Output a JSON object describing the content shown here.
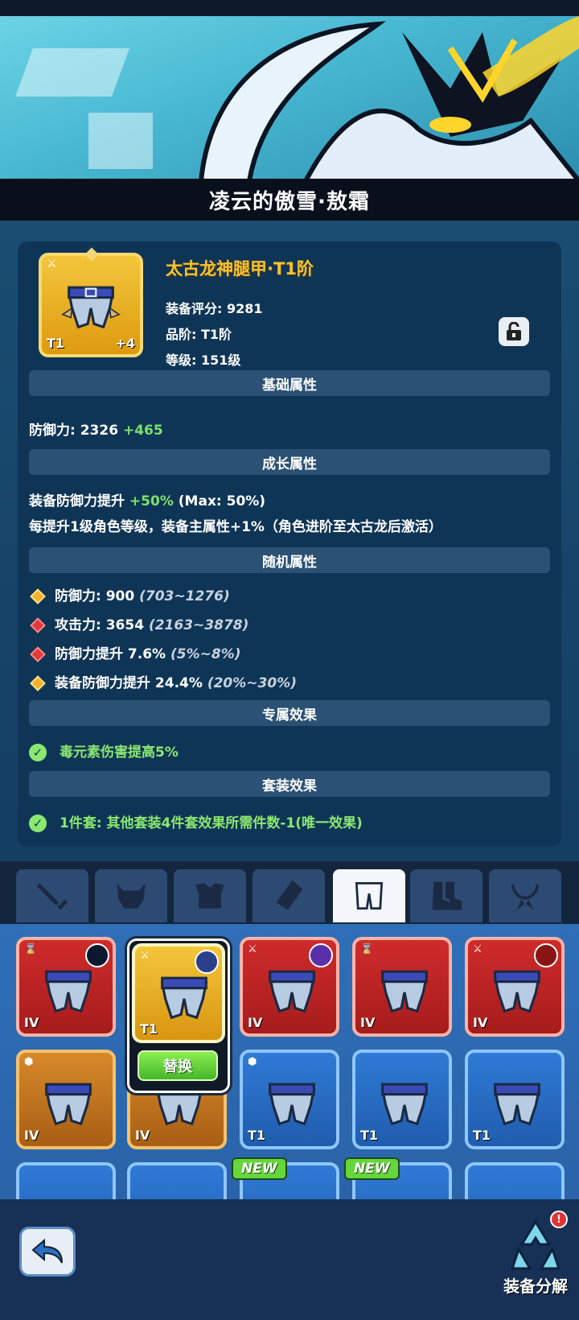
{
  "character_title": "凌云的傲雪·敖霜",
  "item": {
    "name": "太古龙神腿甲·T1阶",
    "score": "装备评分: 9281",
    "grade": "品阶: T1阶",
    "level": "等级: 151级",
    "tier_badge": "T1",
    "plus_badge": "+4",
    "icon_name": "leg-armor-icon"
  },
  "sections": {
    "basic": "基础属性",
    "growth": "成长属性",
    "random": "随机属性",
    "exclusive": "专属效果",
    "set": "套装效果"
  },
  "basic_attr": {
    "label": "防御力: 2326",
    "bonus": "+465"
  },
  "growth_attr": {
    "line1_label": "装备防御力提升",
    "line1_bonus": "+50%",
    "line1_max": "(Max: 50%)",
    "line2": "每提升1级角色等级，装备主属性+1%（角色进阶至太古龙后激活）"
  },
  "random_attrs": [
    {
      "text": "防御力: 900",
      "range": "(703~1276)",
      "gem": "gold"
    },
    {
      "text": "攻击力: 3654",
      "range": "(2163~3878)",
      "gem": "red"
    },
    {
      "text": "防御力提升 7.6%",
      "range": "(5%~8%)",
      "gem": "red"
    },
    {
      "text": "装备防御力提升 24.4%",
      "range": "(20%~30%)",
      "gem": "gold"
    }
  ],
  "exclusive_effect": "毒元素伤害提高5%",
  "set_effect": "1件套: 其他套装4件套效果所需件数-1(唯一效果)",
  "tabs": [
    "weapon",
    "helmet",
    "chest",
    "gloves",
    "legs",
    "boots",
    "necklace"
  ],
  "active_tab": "legs",
  "inventory": {
    "row1": [
      {
        "tier": "IV",
        "color": "red"
      },
      {
        "tier": "T1",
        "color": "gold",
        "selected": true
      },
      {
        "tier": "IV",
        "color": "red"
      },
      {
        "tier": "IV",
        "color": "red"
      },
      {
        "tier": "IV",
        "color": "red"
      }
    ],
    "row2": [
      {
        "tier": "IV",
        "color": "orange"
      },
      {
        "tier": "IV",
        "color": "orange"
      },
      {
        "tier": "T1",
        "color": "blue"
      },
      {
        "tier": "T1",
        "color": "blue"
      },
      {
        "tier": "T1",
        "color": "blue"
      }
    ],
    "replace_label": "替换",
    "new_label": "NEW"
  },
  "bottom": {
    "salvage_label": "装备分解",
    "alert": "!"
  }
}
